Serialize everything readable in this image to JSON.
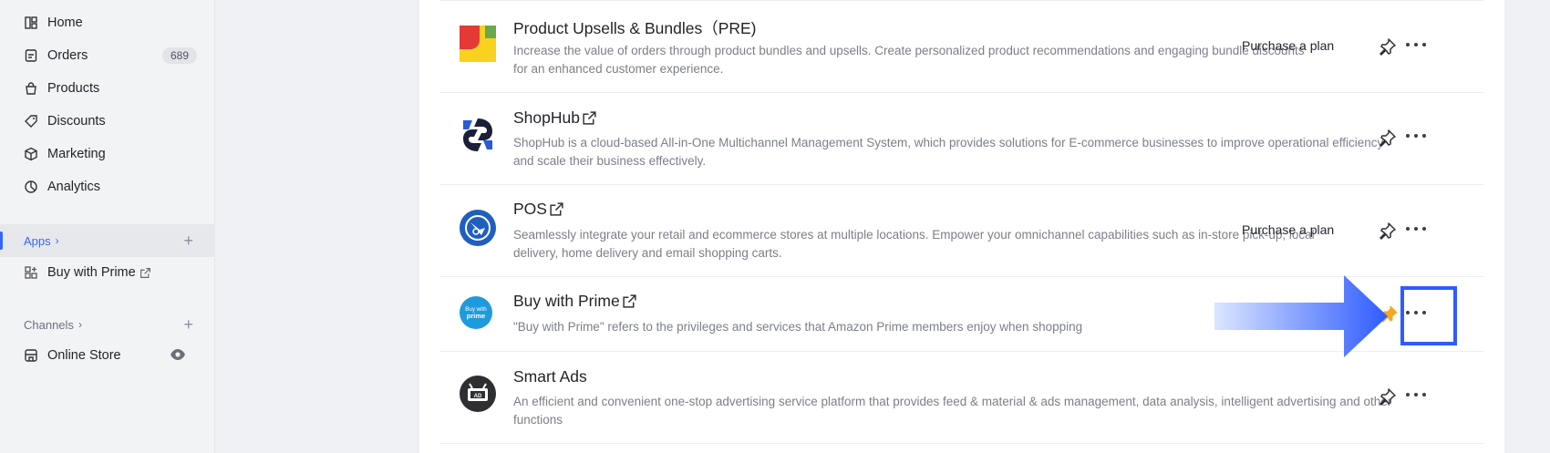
{
  "sidebar": {
    "nav": [
      {
        "label": "Home",
        "icon": "home-icon"
      },
      {
        "label": "Orders",
        "icon": "orders-icon",
        "badge": "689"
      },
      {
        "label": "Products",
        "icon": "bag-icon"
      },
      {
        "label": "Discounts",
        "icon": "tag-icon"
      },
      {
        "label": "Marketing",
        "icon": "box-icon"
      },
      {
        "label": "Analytics",
        "icon": "pie-chart-icon"
      }
    ],
    "apps": {
      "label": "Apps",
      "items": [
        {
          "label": "Buy with Prime",
          "icon": "apps-icon"
        }
      ]
    },
    "channels": {
      "label": "Channels",
      "items": [
        {
          "label": "Online Store",
          "icon": "store-icon"
        }
      ]
    }
  },
  "apps_list": [
    {
      "title": "Product Upsells & Bundles（PRE)",
      "description": "Increase the value of orders through product bundles and upsells. Create personalized product recommendations and engaging bundle discounts for an enhanced customer experience.",
      "action": "Purchase a plan",
      "pinned": false
    },
    {
      "title": "ShopHub",
      "description": "ShopHub is a cloud-based All-in-One Multichannel Management System, which provides solutions for E-commerce businesses to improve operational efficiency and scale their business effectively.",
      "action": "",
      "pinned": false
    },
    {
      "title": "POS",
      "description": "Seamlessly integrate your retail and ecommerce stores at multiple locations. Empower your omnichannel capabilities such as in-store pick-up, local delivery, home delivery and email shopping carts.",
      "action": "Purchase a plan",
      "pinned": false
    },
    {
      "title": "Buy with Prime",
      "description": "\"Buy with Prime\" refers to the privileges and services that Amazon Prime members enjoy when shopping",
      "action": "",
      "pinned": true,
      "logo_text": "Buy with prime"
    },
    {
      "title": "Smart Ads",
      "description": "An efficient and convenient one-stop advertising service platform that provides feed & material & ads management, data analysis, intelligent advertising and other functions",
      "action": "",
      "pinned": false,
      "logo_text": "AD"
    }
  ],
  "colors": {
    "accent": "#3366ff",
    "pinned": "#f5a623",
    "annotation": "#2f5bff"
  }
}
